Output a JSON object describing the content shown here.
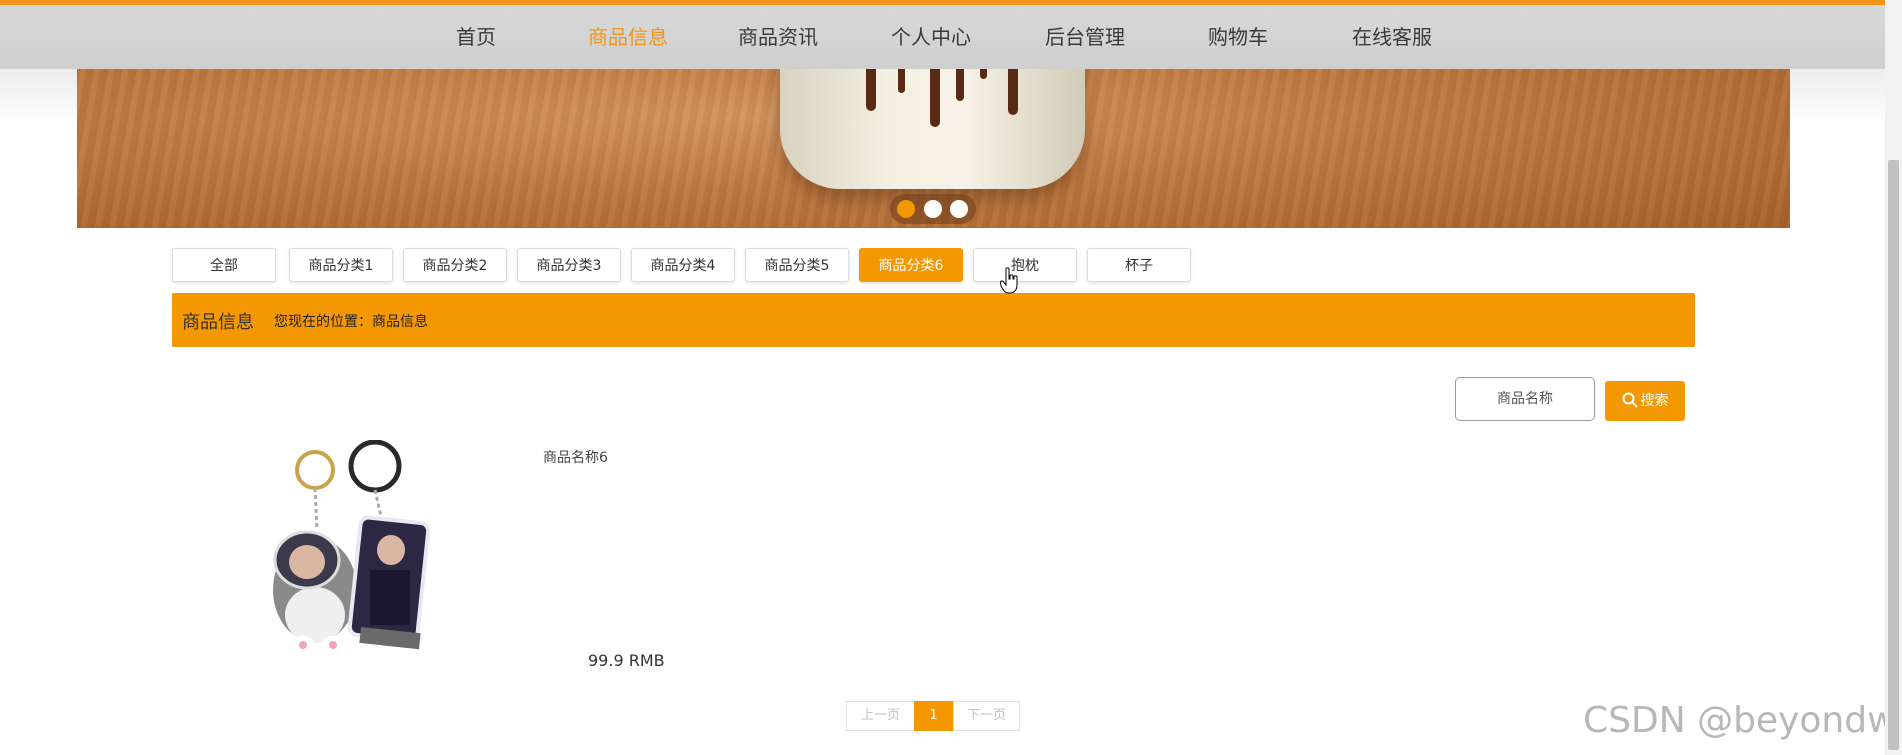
{
  "nav": {
    "items": [
      {
        "label": "首页",
        "active": false
      },
      {
        "label": "商品信息",
        "active": true
      },
      {
        "label": "商品资讯",
        "active": false
      },
      {
        "label": "个人中心",
        "active": false
      },
      {
        "label": "后台管理",
        "active": false
      },
      {
        "label": "购物车",
        "active": false
      },
      {
        "label": "在线客服",
        "active": false
      }
    ]
  },
  "carousel": {
    "slide_count": 3,
    "active_index": 0
  },
  "categories": {
    "items": [
      "全部",
      "商品分类1",
      "商品分类2",
      "商品分类3",
      "商品分类4",
      "商品分类5",
      "商品分类6",
      "抱枕",
      "杯子"
    ],
    "active_index": 6
  },
  "breadcrumb": {
    "title": "商品信息",
    "location": "您现在的位置：商品信息"
  },
  "search": {
    "placeholder": "商品名称",
    "button_label": "搜索",
    "icon": "search-icon"
  },
  "products": [
    {
      "name": "商品名称6",
      "price": "99.9 RMB",
      "image": "acrylic-keychain-photo"
    }
  ],
  "pagination": {
    "prev_label": "上一页",
    "current_page": "1",
    "next_label": "下一页"
  },
  "watermark": "CSDN @beyondwild",
  "colors": {
    "accent": "#f39800",
    "nav_bg": "#d4d4d4",
    "banner_wood": "#c07a42",
    "text": "#333333"
  }
}
